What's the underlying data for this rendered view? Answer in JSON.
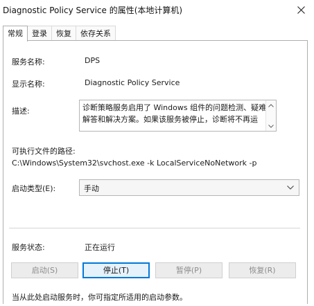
{
  "window": {
    "title": "Diagnostic Policy Service 的属性(本地计算机)"
  },
  "tabs": [
    {
      "label": "常规",
      "active": true
    },
    {
      "label": "登录",
      "active": false
    },
    {
      "label": "恢复",
      "active": false
    },
    {
      "label": "依存关系",
      "active": false
    }
  ],
  "general": {
    "service_name_label": "服务名称:",
    "service_name_value": "DPS",
    "display_name_label": "显示名称:",
    "display_name_value": "Diagnostic Policy Service",
    "description_label": "描述:",
    "description_value": "诊断策略服务启用了 Windows 组件的问题检测、疑难解答和解决方案。如果该服务被停止，诊断将不再运",
    "path_label": "可执行文件的路径:",
    "path_value": "C:\\Windows\\System32\\svchost.exe -k LocalServiceNoNetwork -p",
    "startup_type_label": "启动类型(E):",
    "startup_type_value": "手动",
    "status_label": "服务状态:",
    "status_value": "正在运行",
    "buttons": {
      "start": "启动(S)",
      "stop": "停止(T)",
      "pause": "暂停(P)",
      "resume": "恢复(R)"
    },
    "footer_text": "当从此处启动服务时，你可指定所适用的启动参数。"
  },
  "icons": {
    "close": "close-icon",
    "dropdown": "chevron-down-icon"
  }
}
